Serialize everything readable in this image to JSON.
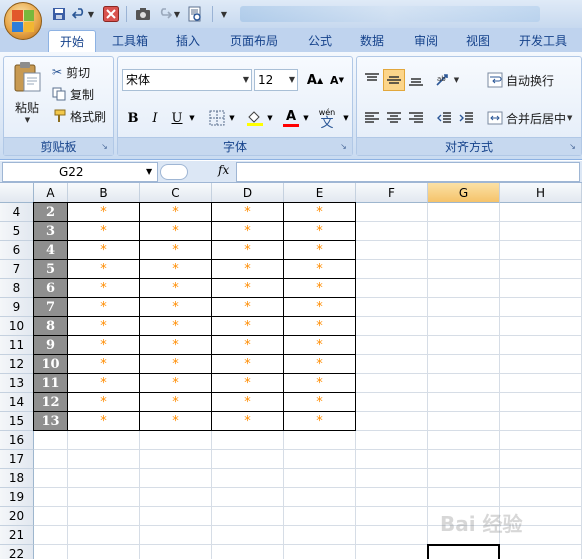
{
  "quick_access": {
    "icons": [
      "save-icon",
      "undo-icon",
      "undo-dropdown-icon",
      "close-icon",
      "camera-icon",
      "redo-icon",
      "print-preview-icon",
      "customize-dropdown-icon"
    ]
  },
  "tabs": [
    {
      "label": "开始",
      "active": true
    },
    {
      "label": "工具箱",
      "active": false
    },
    {
      "label": "插入",
      "active": false
    },
    {
      "label": "页面布局",
      "active": false
    },
    {
      "label": "公式",
      "active": false
    },
    {
      "label": "数据",
      "active": false
    },
    {
      "label": "审阅",
      "active": false
    },
    {
      "label": "视图",
      "active": false
    },
    {
      "label": "开发工具",
      "active": false
    }
  ],
  "clipboard": {
    "paste_label": "粘贴",
    "cut_label": "剪切",
    "copy_label": "复制",
    "format_painter_label": "格式刷",
    "group_label": "剪贴板"
  },
  "font": {
    "font_name": "宋体",
    "font_size": "12",
    "bold": "B",
    "italic": "I",
    "underline": "U",
    "grow": "A",
    "shrink": "A",
    "font_color_letter": "A",
    "phonetic_top": "wén",
    "phonetic_bottom": "文",
    "group_label": "字体"
  },
  "alignment": {
    "wrap_text_label": "自动换行",
    "merge_center_label": "合并后居中",
    "group_label": "对齐方式"
  },
  "formula_bar": {
    "name_box": "G22",
    "fx": "fx",
    "formula": ""
  },
  "grid": {
    "columns": [
      "A",
      "B",
      "C",
      "D",
      "E",
      "F",
      "G",
      "H"
    ],
    "selected_column": "G",
    "rows": [
      {
        "row": "4",
        "a": "2",
        "b": "*",
        "c": "*",
        "d": "*",
        "e": "*"
      },
      {
        "row": "5",
        "a": "3",
        "b": "*",
        "c": "*",
        "d": "*",
        "e": "*"
      },
      {
        "row": "6",
        "a": "4",
        "b": "*",
        "c": "*",
        "d": "*",
        "e": "*"
      },
      {
        "row": "7",
        "a": "5",
        "b": "*",
        "c": "*",
        "d": "*",
        "e": "*"
      },
      {
        "row": "8",
        "a": "6",
        "b": "*",
        "c": "*",
        "d": "*",
        "e": "*"
      },
      {
        "row": "9",
        "a": "7",
        "b": "*",
        "c": "*",
        "d": "*",
        "e": "*"
      },
      {
        "row": "10",
        "a": "8",
        "b": "*",
        "c": "*",
        "d": "*",
        "e": "*"
      },
      {
        "row": "11",
        "a": "9",
        "b": "*",
        "c": "*",
        "d": "*",
        "e": "*"
      },
      {
        "row": "12",
        "a": "10",
        "b": "*",
        "c": "*",
        "d": "*",
        "e": "*"
      },
      {
        "row": "13",
        "a": "11",
        "b": "*",
        "c": "*",
        "d": "*",
        "e": "*"
      },
      {
        "row": "14",
        "a": "12",
        "b": "*",
        "c": "*",
        "d": "*",
        "e": "*"
      },
      {
        "row": "15",
        "a": "13",
        "b": "*",
        "c": "*",
        "d": "*",
        "e": "*"
      },
      {
        "row": "16"
      },
      {
        "row": "17"
      },
      {
        "row": "18"
      },
      {
        "row": "19"
      },
      {
        "row": "20"
      },
      {
        "row": "21"
      },
      {
        "row": "22"
      }
    ]
  },
  "watermark": "Bai 经验",
  "colors": {
    "star": "#ff8c00",
    "number_fill": "#8f8f8f",
    "selected_header": "#f5c36a",
    "ribbon_text": "#15428b"
  }
}
